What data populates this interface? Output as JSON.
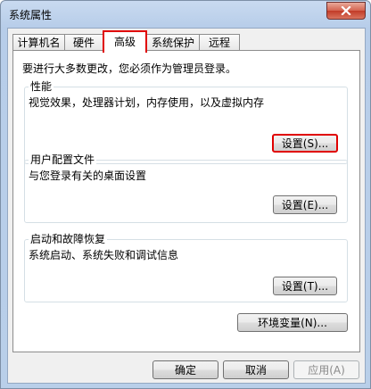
{
  "window": {
    "title": "系统属性"
  },
  "tabs": [
    {
      "label": "计算机名",
      "active": false
    },
    {
      "label": "硬件",
      "active": false
    },
    {
      "label": "高级",
      "active": true
    },
    {
      "label": "系统保护",
      "active": false
    },
    {
      "label": "远程",
      "active": false
    }
  ],
  "advanced": {
    "admin_note": "要进行大多数更改，您必须作为管理员登录。",
    "performance": {
      "title": "性能",
      "description": "视觉效果，处理器计划，内存使用，以及虚拟内存",
      "settings_label": "设置(S)..."
    },
    "user_profiles": {
      "title": "用户配置文件",
      "description": "与您登录有关的桌面设置",
      "settings_label": "设置(E)..."
    },
    "startup_recovery": {
      "title": "启动和故障恢复",
      "description": "系统启动、系统失败和调试信息",
      "settings_label": "设置(T)..."
    },
    "env_vars_label": "环境变量(N)..."
  },
  "footer": {
    "ok_label": "确定",
    "cancel_label": "取消",
    "apply_label": "应用(A)"
  },
  "colors": {
    "highlight_red": "#e00000",
    "title_bar": "#c9daf0",
    "dialog_bg": "#f0f0f0"
  },
  "icons": {
    "close": "close-icon"
  }
}
